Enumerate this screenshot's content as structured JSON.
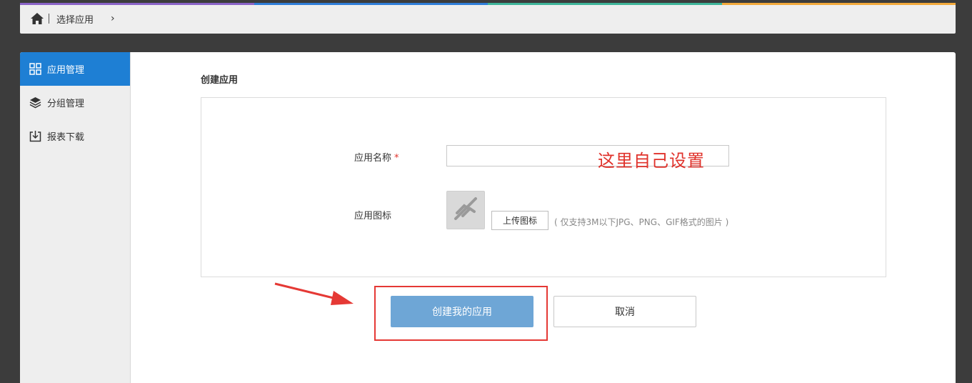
{
  "stripe_colors": [
    "#8a63c7",
    "#2f7ed8",
    "#3fb59a",
    "#f2a93b"
  ],
  "breadcrumb": {
    "home_icon": "home-icon",
    "current": "选择应用",
    "chevron": "›"
  },
  "sidebar": {
    "items": [
      {
        "label": "应用管理",
        "icon": "grid-icon",
        "active": true
      },
      {
        "label": "分组管理",
        "icon": "layers-icon",
        "active": false
      },
      {
        "label": "报表下载",
        "icon": "download-icon",
        "active": false
      }
    ]
  },
  "main": {
    "section_title": "创建应用",
    "form": {
      "name_label": "应用名称",
      "required_mark": "*",
      "name_value": "",
      "annotation": "这里自己设置",
      "icon_label": "应用图标",
      "upload_label": "上传图标",
      "upload_hint": "( 仅支持3M以下JPG、PNG、GIF格式的图片 )"
    },
    "actions": {
      "create_label": "创建我的应用",
      "cancel_label": "取消"
    }
  },
  "colors": {
    "active_blue": "#1e7fd4",
    "create_button": "#6ea6d6",
    "highlight_red": "#e53935"
  }
}
